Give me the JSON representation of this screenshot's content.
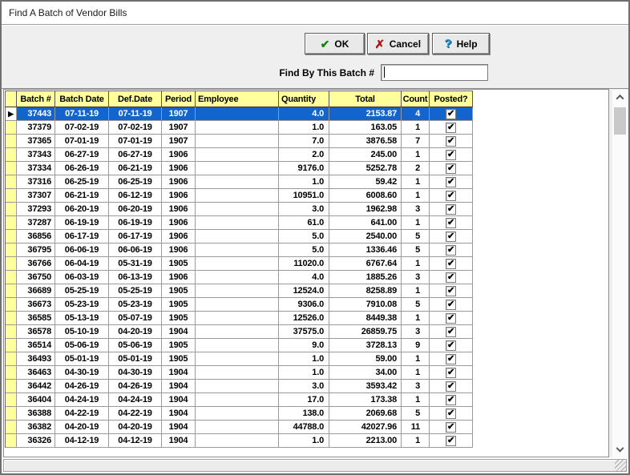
{
  "window": {
    "title": "Find A Batch of Vendor Bills"
  },
  "toolbar": {
    "ok_label": "OK",
    "cancel_label": "Cancel",
    "help_label": "Help",
    "ok_icon": "✔",
    "cancel_icon": "✗",
    "help_icon": "?",
    "find_label": "Find By This Batch #",
    "find_value": ""
  },
  "grid": {
    "columns": [
      "Batch #",
      "Batch Date",
      "Def.Date",
      "Period",
      "Employee",
      "Quantity",
      "Total",
      "Count",
      "Posted?"
    ],
    "selected_row_index": 0,
    "selector_glyph": "▶",
    "checked_glyph": "✔",
    "rows": [
      {
        "batch": "37443",
        "batch_date": "07-11-19",
        "def_date": "07-11-19",
        "period": "1907",
        "employee": "",
        "quantity": "4.0",
        "total": "2153.87",
        "count": "4",
        "posted": true
      },
      {
        "batch": "37379",
        "batch_date": "07-02-19",
        "def_date": "07-02-19",
        "period": "1907",
        "employee": "",
        "quantity": "1.0",
        "total": "163.05",
        "count": "1",
        "posted": true
      },
      {
        "batch": "37365",
        "batch_date": "07-01-19",
        "def_date": "07-01-19",
        "period": "1907",
        "employee": "",
        "quantity": "7.0",
        "total": "3876.58",
        "count": "7",
        "posted": true
      },
      {
        "batch": "37343",
        "batch_date": "06-27-19",
        "def_date": "06-27-19",
        "period": "1906",
        "employee": "",
        "quantity": "2.0",
        "total": "245.00",
        "count": "1",
        "posted": true
      },
      {
        "batch": "37334",
        "batch_date": "06-26-19",
        "def_date": "06-21-19",
        "period": "1906",
        "employee": "",
        "quantity": "9176.0",
        "total": "5252.78",
        "count": "2",
        "posted": true
      },
      {
        "batch": "37316",
        "batch_date": "06-25-19",
        "def_date": "06-25-19",
        "period": "1906",
        "employee": "",
        "quantity": "1.0",
        "total": "59.42",
        "count": "1",
        "posted": true
      },
      {
        "batch": "37307",
        "batch_date": "06-21-19",
        "def_date": "06-12-19",
        "period": "1906",
        "employee": "",
        "quantity": "10951.0",
        "total": "6008.60",
        "count": "1",
        "posted": true
      },
      {
        "batch": "37293",
        "batch_date": "06-20-19",
        "def_date": "06-20-19",
        "period": "1906",
        "employee": "",
        "quantity": "3.0",
        "total": "1962.98",
        "count": "3",
        "posted": true
      },
      {
        "batch": "37287",
        "batch_date": "06-19-19",
        "def_date": "06-19-19",
        "period": "1906",
        "employee": "",
        "quantity": "61.0",
        "total": "641.00",
        "count": "1",
        "posted": true
      },
      {
        "batch": "36856",
        "batch_date": "06-17-19",
        "def_date": "06-17-19",
        "period": "1906",
        "employee": "",
        "quantity": "5.0",
        "total": "2540.00",
        "count": "5",
        "posted": true
      },
      {
        "batch": "36795",
        "batch_date": "06-06-19",
        "def_date": "06-06-19",
        "period": "1906",
        "employee": "",
        "quantity": "5.0",
        "total": "1336.46",
        "count": "5",
        "posted": true
      },
      {
        "batch": "36766",
        "batch_date": "06-04-19",
        "def_date": "05-31-19",
        "period": "1905",
        "employee": "",
        "quantity": "11020.0",
        "total": "6767.64",
        "count": "1",
        "posted": true
      },
      {
        "batch": "36750",
        "batch_date": "06-03-19",
        "def_date": "06-13-19",
        "period": "1906",
        "employee": "",
        "quantity": "4.0",
        "total": "1885.26",
        "count": "3",
        "posted": true
      },
      {
        "batch": "36689",
        "batch_date": "05-25-19",
        "def_date": "05-25-19",
        "period": "1905",
        "employee": "",
        "quantity": "12524.0",
        "total": "8258.89",
        "count": "1",
        "posted": true
      },
      {
        "batch": "36673",
        "batch_date": "05-23-19",
        "def_date": "05-23-19",
        "period": "1905",
        "employee": "",
        "quantity": "9306.0",
        "total": "7910.08",
        "count": "5",
        "posted": true
      },
      {
        "batch": "36585",
        "batch_date": "05-13-19",
        "def_date": "05-07-19",
        "period": "1905",
        "employee": "",
        "quantity": "12526.0",
        "total": "8449.38",
        "count": "1",
        "posted": true
      },
      {
        "batch": "36578",
        "batch_date": "05-10-19",
        "def_date": "04-20-19",
        "period": "1904",
        "employee": "",
        "quantity": "37575.0",
        "total": "26859.75",
        "count": "3",
        "posted": true
      },
      {
        "batch": "36514",
        "batch_date": "05-06-19",
        "def_date": "05-06-19",
        "period": "1905",
        "employee": "",
        "quantity": "9.0",
        "total": "3728.13",
        "count": "9",
        "posted": true
      },
      {
        "batch": "36493",
        "batch_date": "05-01-19",
        "def_date": "05-01-19",
        "period": "1905",
        "employee": "",
        "quantity": "1.0",
        "total": "59.00",
        "count": "1",
        "posted": true
      },
      {
        "batch": "36463",
        "batch_date": "04-30-19",
        "def_date": "04-30-19",
        "period": "1904",
        "employee": "",
        "quantity": "1.0",
        "total": "34.00",
        "count": "1",
        "posted": true
      },
      {
        "batch": "36442",
        "batch_date": "04-26-19",
        "def_date": "04-26-19",
        "period": "1904",
        "employee": "",
        "quantity": "3.0",
        "total": "3593.42",
        "count": "3",
        "posted": true
      },
      {
        "batch": "36404",
        "batch_date": "04-24-19",
        "def_date": "04-24-19",
        "period": "1904",
        "employee": "",
        "quantity": "17.0",
        "total": "173.38",
        "count": "1",
        "posted": true
      },
      {
        "batch": "36388",
        "batch_date": "04-22-19",
        "def_date": "04-22-19",
        "period": "1904",
        "employee": "",
        "quantity": "138.0",
        "total": "2069.68",
        "count": "5",
        "posted": true
      },
      {
        "batch": "36382",
        "batch_date": "04-20-19",
        "def_date": "04-20-19",
        "period": "1904",
        "employee": "",
        "quantity": "44788.0",
        "total": "42027.96",
        "count": "11",
        "posted": true
      },
      {
        "batch": "36326",
        "batch_date": "04-12-19",
        "def_date": "04-12-19",
        "period": "1904",
        "employee": "",
        "quantity": "1.0",
        "total": "2213.00",
        "count": "1",
        "posted": true
      }
    ]
  },
  "colors": {
    "selected_row_bg": "#1464ce",
    "header_bg": "#ffff9c",
    "check_green": "#0c8a0c",
    "cancel_red": "#b41414",
    "help_blue": "#1d8fd2"
  }
}
